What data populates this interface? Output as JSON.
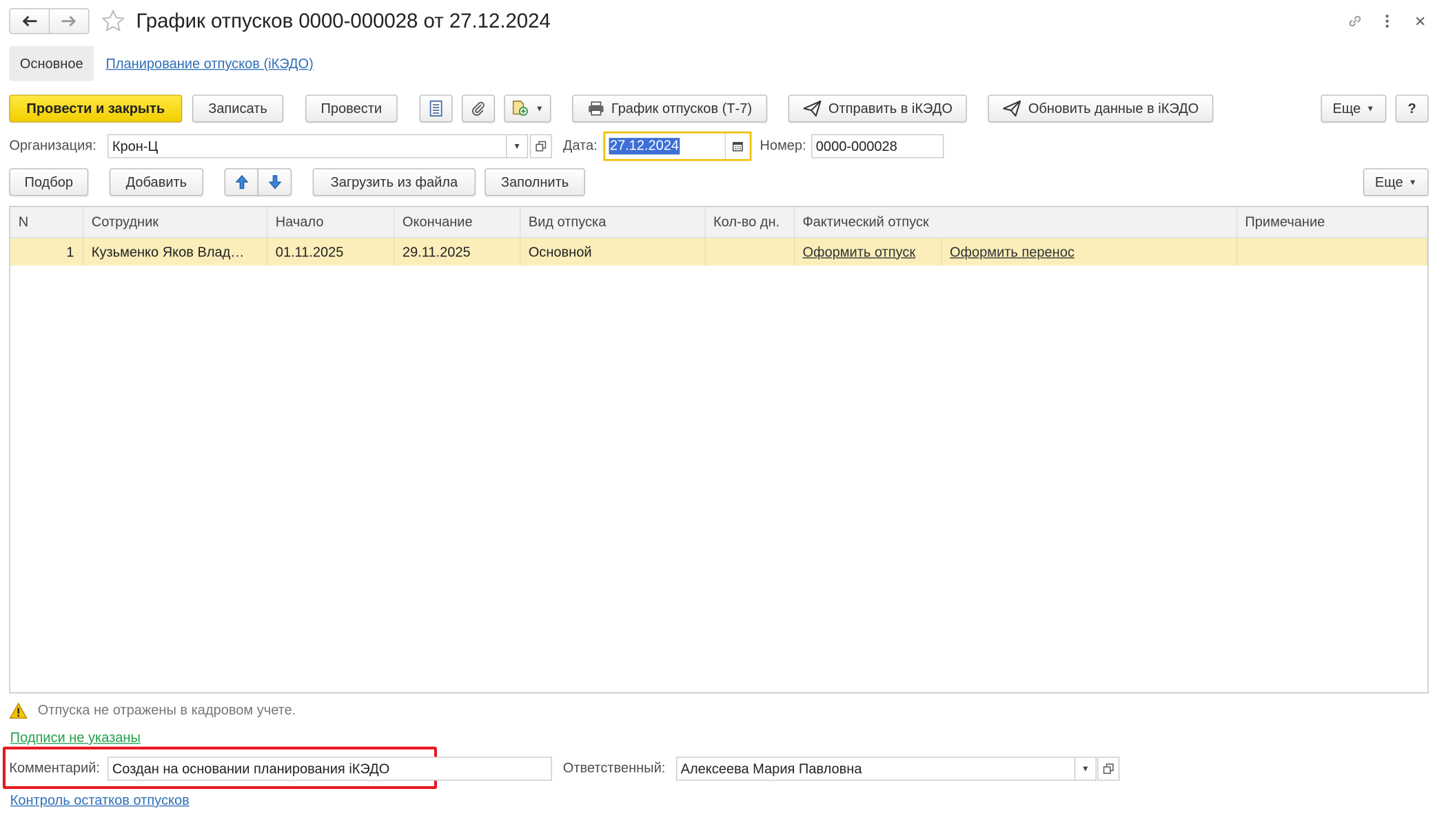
{
  "window": {
    "title": "График отпусков 0000-000028 от 27.12.2024"
  },
  "tabs": {
    "main": "Основное",
    "planning_link": "Планирование отпусков (iКЭДО)"
  },
  "toolbar": {
    "post_close": "Провести и закрыть",
    "save": "Записать",
    "post": "Провести",
    "print_t7": "График отпусков (Т-7)",
    "send_ikedo": "Отправить в iКЭДО",
    "update_ikedo": "Обновить данные в iКЭДО",
    "more": "Еще",
    "help": "?"
  },
  "header_fields": {
    "org_label": "Организация:",
    "org_value": "Крон-Ц",
    "date_label": "Дата:",
    "date_value": "27.12.2024",
    "number_label": "Номер:",
    "number_value": "0000-000028"
  },
  "table_toolbar": {
    "pick": "Подбор",
    "add": "Добавить",
    "load_file": "Загрузить из файла",
    "fill": "Заполнить",
    "more": "Еще"
  },
  "table": {
    "columns": [
      "N",
      "Сотрудник",
      "Начало",
      "Окончание",
      "Вид отпуска",
      "Кол-во дн.",
      "Фактический отпуск",
      "Примечание"
    ],
    "rows": [
      {
        "n": "1",
        "employee": "Кузьменко Яков Влад…",
        "start": "01.11.2025",
        "end": "29.11.2025",
        "kind": "Основной",
        "days": "",
        "action_vacation": "Оформить отпуск",
        "action_transfer": "Оформить перенос",
        "note": ""
      }
    ]
  },
  "footer": {
    "warning": "Отпуска не отражены в кадровом учете.",
    "signatures_link": "Подписи не указаны",
    "comment_label": "Комментарий:",
    "comment_value": "Создан на основании планирования iКЭДО",
    "responsible_label": "Ответственный:",
    "responsible_value": "Алексеева Мария Павловна",
    "balance_link": "Контроль остатков отпусков"
  },
  "colors": {
    "primary_button": "#f5d400",
    "selected_row": "#fbeeba",
    "link": "#2f6fb8",
    "green_link": "#22a04a",
    "highlight_box": "#e8141c",
    "date_focus": "#f0c000",
    "date_selection": "#3d6fd6"
  }
}
